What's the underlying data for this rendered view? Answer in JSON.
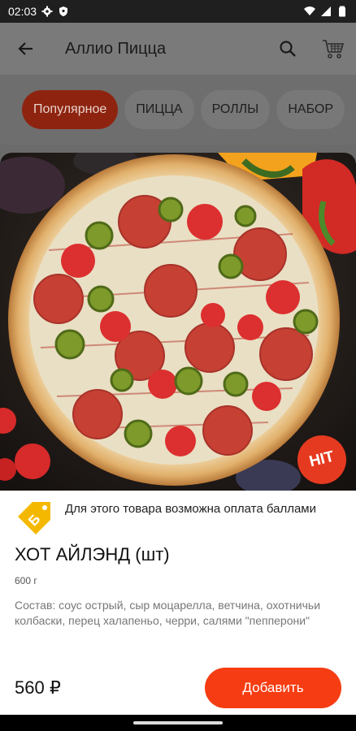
{
  "status_bar": {
    "time": "02:03"
  },
  "header": {
    "title": "Аллио Пицца"
  },
  "tabs": [
    {
      "label": "Популярное",
      "active": true
    },
    {
      "label": "ПИЦЦА",
      "active": false
    },
    {
      "label": "РОЛЛЫ",
      "active": false
    },
    {
      "label": "НАБОР",
      "active": false
    }
  ],
  "product": {
    "badge": "HIT",
    "points_notice": "Для этого товара возможна оплата баллами",
    "points_icon_label": "Б",
    "title": "ХОТ АЙЛЭНД (шт)",
    "weight": "600 г",
    "description": "Состав: соус острый, сыр моцарелла, ветчина, охотничьи колбаски, перец халапеньо, черри, салями \"пепперони\"",
    "price": "560 ₽",
    "add_button": "Добавить"
  },
  "colors": {
    "accent": "#f63c12",
    "active_tab": "#8e2410",
    "badge": "#e63a20",
    "points_tag": "#f5b800"
  }
}
